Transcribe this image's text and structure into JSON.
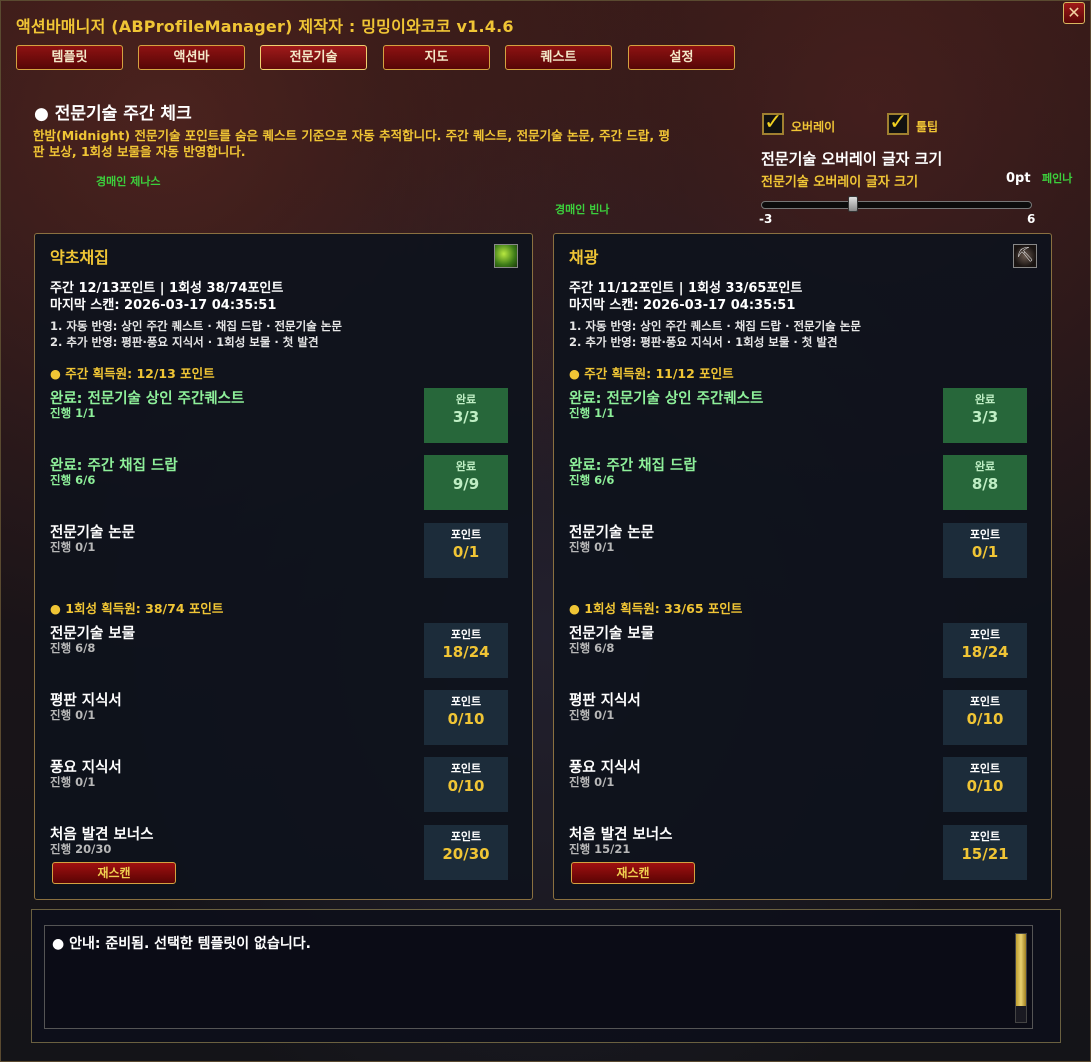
{
  "window": {
    "title": "액션바매니저 (ABProfileManager) 제작자 : 밍밍이와코코  v1.4.6",
    "close_label": "✕"
  },
  "tabs": [
    "템플릿",
    "액션바",
    "전문기술",
    "지도",
    "퀘스트",
    "설정"
  ],
  "active_tab": "전문기술",
  "section": {
    "title": "● 전문기술 주간 체크",
    "description": "한밤(Midnight) 전문기술 포인트를 숨은 퀘스트 기준으로 자동 추적합니다. 주간 퀘스트, 전문기술 논문, 주간 드랍, 평판 보상, 1회성 보물을 자동 반영합니다."
  },
  "background_labels": [
    "경매인 제나스",
    "경매인 빈나",
    "페인나"
  ],
  "options": {
    "overlay_label": "오버레이",
    "overlay_checked": true,
    "tooltip_label": "툴팁",
    "tooltip_checked": true,
    "font_size_title": "전문기술 오버레이 글자 크기",
    "font_size_sub": "전문기술 오버레이 글자 크기",
    "font_size_value": "0pt",
    "slider_min": "-3",
    "slider_max": "6",
    "slider_value": 0
  },
  "panels": [
    {
      "title": "약초채집",
      "icon": "herbalism-icon",
      "summary": "주간 12/13포인트  |  1회성 38/74포인트",
      "last_scan": "마지막 스캔: 2026-03-17 04:35:51",
      "note1": "1. 자동 반영: 상인 주간 퀘스트 · 채집 드랍 · 전문기술 논문",
      "note2": "2. 추가 반영: 평판·풍요 지식서 · 1회성 보물 · 첫 발견",
      "weekly_header": "● 주간 획득원: 12/13 포인트",
      "weekly_items": [
        {
          "name": "완료: 전문기술 상인 주간퀘스트",
          "progress": "진행 1/1",
          "badge_label": "완료",
          "badge_value": "3/3",
          "done": true
        },
        {
          "name": "완료: 주간 채집 드랍",
          "progress": "진행 6/6",
          "badge_label": "완료",
          "badge_value": "9/9",
          "done": true
        },
        {
          "name": "전문기술 논문",
          "progress": "진행 0/1",
          "badge_label": "포인트",
          "badge_value": "0/1",
          "done": false
        }
      ],
      "onetime_header": "● 1회성 획득원: 38/74 포인트",
      "onetime_items": [
        {
          "name": "전문기술 보물",
          "progress": "진행 6/8",
          "badge_label": "포인트",
          "badge_value": "18/24",
          "done": false
        },
        {
          "name": "평판 지식서",
          "progress": "진행 0/1",
          "badge_label": "포인트",
          "badge_value": "0/10",
          "done": false
        },
        {
          "name": "풍요 지식서",
          "progress": "진행 0/1",
          "badge_label": "포인트",
          "badge_value": "0/10",
          "done": false
        },
        {
          "name": "처음 발견 보너스",
          "progress": "진행 20/30",
          "badge_label": "포인트",
          "badge_value": "20/30",
          "done": false
        }
      ],
      "rescan_label": "재스캔"
    },
    {
      "title": "채광",
      "icon": "mining-pick-icon",
      "summary": "주간 11/12포인트  |  1회성 33/65포인트",
      "last_scan": "마지막 스캔: 2026-03-17 04:35:51",
      "note1": "1. 자동 반영: 상인 주간 퀘스트 · 채집 드랍 · 전문기술 논문",
      "note2": "2. 추가 반영: 평판·풍요 지식서 · 1회성 보물 · 첫 발견",
      "weekly_header": "● 주간 획득원: 11/12 포인트",
      "weekly_items": [
        {
          "name": "완료: 전문기술 상인 주간퀘스트",
          "progress": "진행 1/1",
          "badge_label": "완료",
          "badge_value": "3/3",
          "done": true
        },
        {
          "name": "완료: 주간 채집 드랍",
          "progress": "진행 6/6",
          "badge_label": "완료",
          "badge_value": "8/8",
          "done": true
        },
        {
          "name": "전문기술 논문",
          "progress": "진행 0/1",
          "badge_label": "포인트",
          "badge_value": "0/1",
          "done": false
        }
      ],
      "onetime_header": "● 1회성 획득원: 33/65 포인트",
      "onetime_items": [
        {
          "name": "전문기술 보물",
          "progress": "진행 6/8",
          "badge_label": "포인트",
          "badge_value": "18/24",
          "done": false
        },
        {
          "name": "평판 지식서",
          "progress": "진행 0/1",
          "badge_label": "포인트",
          "badge_value": "0/10",
          "done": false
        },
        {
          "name": "풍요 지식서",
          "progress": "진행 0/1",
          "badge_label": "포인트",
          "badge_value": "0/10",
          "done": false
        },
        {
          "name": "처음 발견 보너스",
          "progress": "진행 15/21",
          "badge_label": "포인트",
          "badge_value": "15/21",
          "done": false
        }
      ],
      "rescan_label": "재스캔"
    }
  ],
  "log": {
    "message": "● 안내: 준비됨. 선택한 템플릿이 없습니다."
  },
  "colors": {
    "accent_gold": "#f0c535",
    "done_green": "#8ef09a",
    "button_red": "#8e1212",
    "bg_label_green": "#3ccf3c"
  }
}
